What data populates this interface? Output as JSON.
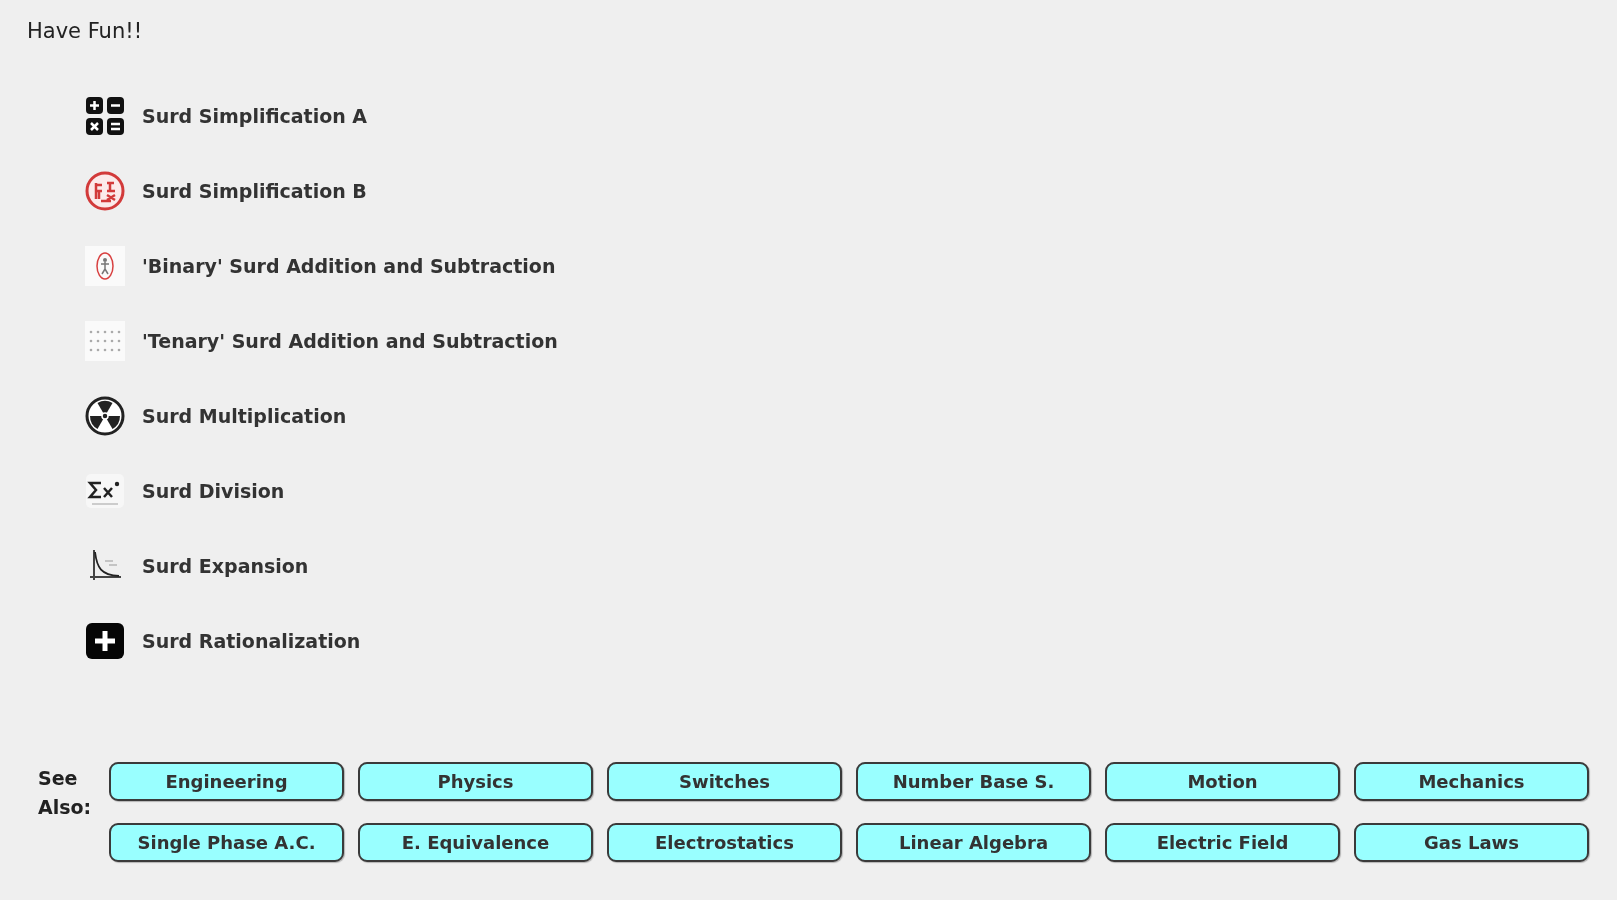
{
  "heading": "Have Fun!!",
  "activities": [
    {
      "label": "Surd Simplification A"
    },
    {
      "label": "Surd Simplification B"
    },
    {
      "label": "'Binary' Surd Addition and Subtraction"
    },
    {
      "label": "'Tenary' Surd Addition and Subtraction"
    },
    {
      "label": "Surd Multiplication"
    },
    {
      "label": "Surd Division"
    },
    {
      "label": "Surd Expansion"
    },
    {
      "label": "Surd Rationalization"
    }
  ],
  "see_also": {
    "label": "See Also:",
    "links": [
      "Engineering",
      "Physics",
      "Switches",
      "Number Base S.",
      "Motion",
      "Mechanics",
      "Single Phase A.C.",
      "E. Equivalence",
      "Electrostatics",
      "Linear Algebra",
      "Electric Field",
      "Gas Laws"
    ]
  }
}
